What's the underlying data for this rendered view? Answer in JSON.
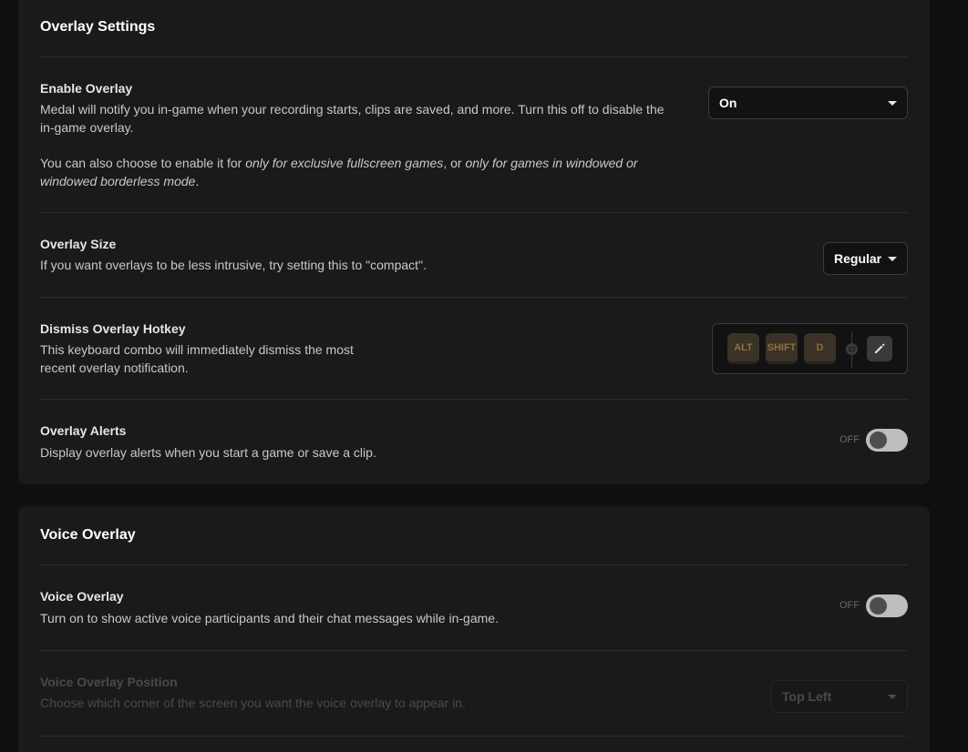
{
  "overlay_settings": {
    "title": "Overlay Settings",
    "enable_overlay": {
      "title": "Enable Overlay",
      "desc1": "Medal will notify you in-game when your recording starts, clips are saved, and more. Turn this off to disable the in-game overlay.",
      "desc2_prefix": "You can also choose to enable it for ",
      "desc2_italic1": "only for exclusive fullscreen games",
      "desc2_mid": ", or ",
      "desc2_italic2": "only for games in windowed or windowed borderless mode",
      "desc2_suffix": ".",
      "value": "On"
    },
    "overlay_size": {
      "title": "Overlay Size",
      "desc": "If you want overlays to be less intrusive, try setting this to \"compact\".",
      "value": "Regular"
    },
    "dismiss_hotkey": {
      "title": "Dismiss Overlay Hotkey",
      "desc": "This keyboard combo will immediately dismiss the most recent overlay notification.",
      "keys": [
        "ALT",
        "SHIFT",
        "D"
      ]
    },
    "overlay_alerts": {
      "title": "Overlay Alerts",
      "desc": "Display overlay alerts when you start a game or save a clip.",
      "state_label": "OFF",
      "enabled": false
    }
  },
  "voice_overlay": {
    "title": "Voice Overlay",
    "voice_toggle": {
      "title": "Voice Overlay",
      "desc": "Turn on to show active voice participants and their chat messages while in-game.",
      "state_label": "OFF",
      "enabled": false
    },
    "position": {
      "title": "Voice Overlay Position",
      "desc": "Choose which corner of the screen you want the voice overlay to appear in.",
      "value": "Top Left",
      "disabled": true
    }
  },
  "colors": {
    "background": "#0f0f0f",
    "panel": "#1a1a1a",
    "key_text": "#8c6f3c",
    "toggle_track": "#bdbdbd"
  }
}
